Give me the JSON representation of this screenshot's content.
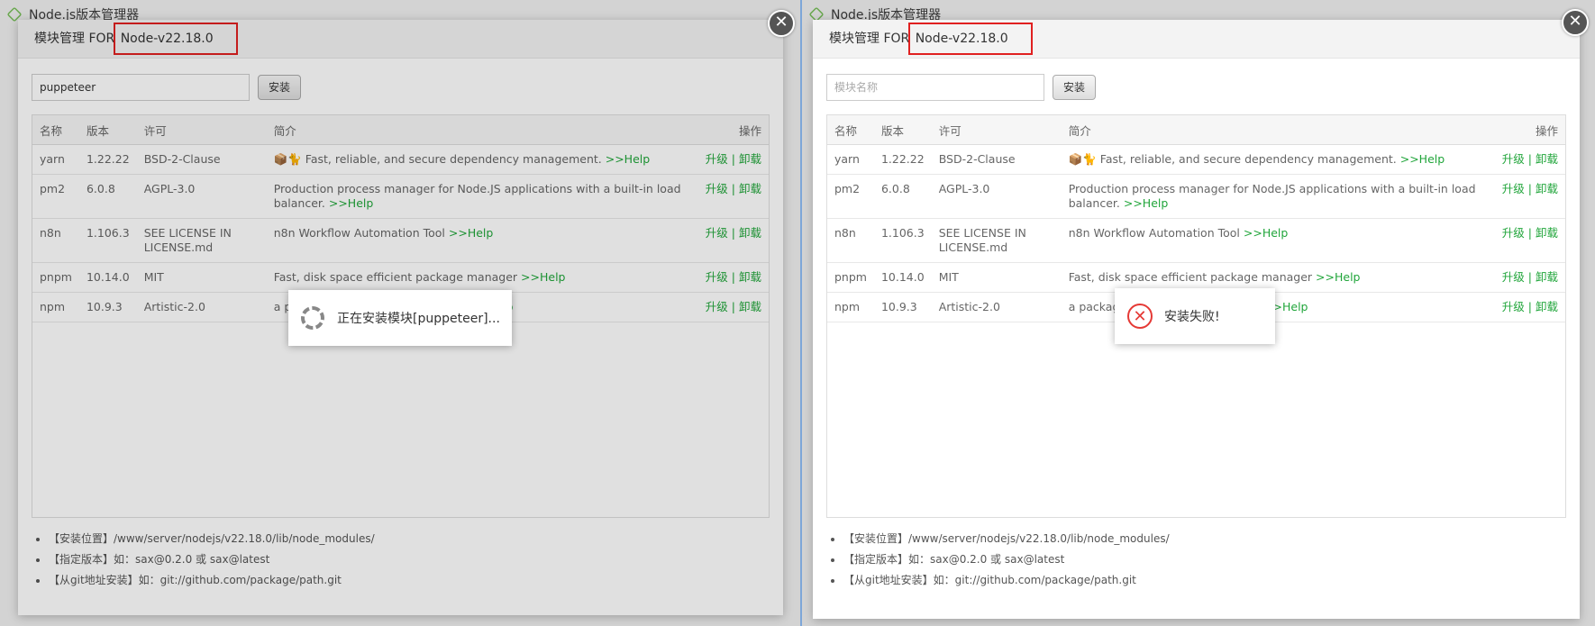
{
  "background": {
    "app_title": "Node.js版本管理器"
  },
  "panels": [
    {
      "title_prefix": "模块管理 FOR ",
      "title_version": "Node-v22.18.0",
      "search": {
        "value": "puppeteer",
        "placeholder": "模块名称"
      },
      "install_label": "安装",
      "toast": {
        "type": "loading",
        "text": "正在安装模块[puppeteer]..."
      }
    },
    {
      "title_prefix": "模块管理 FOR ",
      "title_version": "Node-v22.18.0",
      "search": {
        "value": "",
        "placeholder": "模块名称"
      },
      "install_label": "安装",
      "toast": {
        "type": "error",
        "text": "安装失败!"
      }
    }
  ],
  "table": {
    "headers": {
      "name": "名称",
      "version": "版本",
      "license": "许可",
      "desc": "简介",
      "ops": "操作"
    },
    "rows": [
      {
        "name": "yarn",
        "version": "1.22.22",
        "license": "BSD-2-Clause",
        "desc": "📦🐈 Fast, reliable, and secure dependency management.",
        "help": ">>Help"
      },
      {
        "name": "pm2",
        "version": "6.0.8",
        "license": "AGPL-3.0",
        "desc": "Production process manager for Node.JS applications with a built-in load balancer.",
        "help": ">>Help"
      },
      {
        "name": "n8n",
        "version": "1.106.3",
        "license": "SEE LICENSE IN LICENSE.md",
        "desc": "n8n Workflow Automation Tool",
        "help": ">>Help"
      },
      {
        "name": "pnpm",
        "version": "10.14.0",
        "license": "MIT",
        "desc": "Fast, disk space efficient package manager",
        "help": ">>Help"
      },
      {
        "name": "npm",
        "version": "10.9.3",
        "license": "Artistic-2.0",
        "desc": "a package manager for JavaScript",
        "help": ">>Help"
      }
    ],
    "upgrade_label": "升级",
    "uninstall_label": "卸载",
    "op_separator": "|"
  },
  "notes": [
    "【安装位置】/www/server/nodejs/v22.18.0/lib/node_modules/",
    "【指定版本】如：sax@0.2.0 或 sax@latest",
    "【从git地址安装】如：git://github.com/package/path.git"
  ],
  "close_symbol": "✕",
  "colors": {
    "accent": "#20a53a",
    "highlight": "#e02020",
    "error": "#e53935"
  }
}
